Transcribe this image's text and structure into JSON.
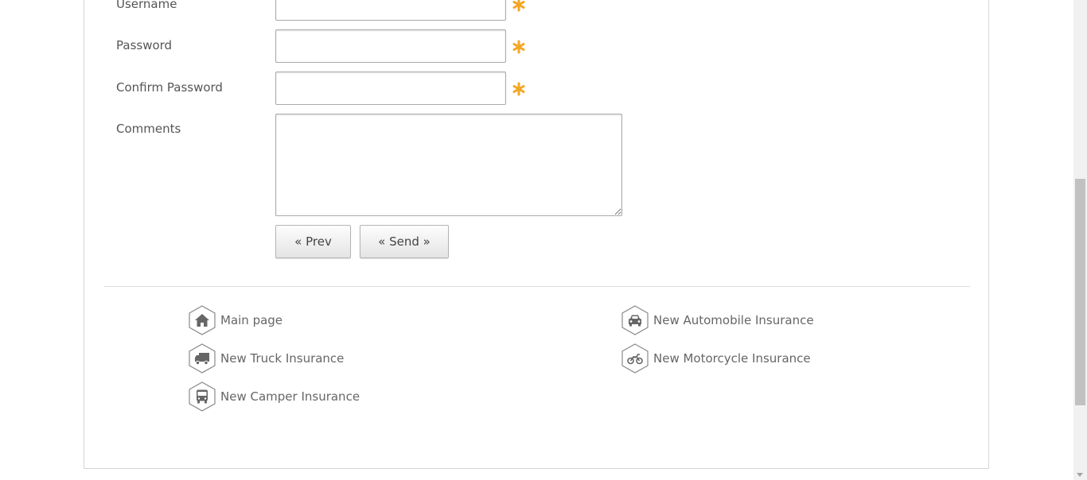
{
  "form": {
    "username": {
      "label": "Username",
      "value": "",
      "placeholder": ""
    },
    "password": {
      "label": "Password",
      "value": "",
      "placeholder": ""
    },
    "confirm_password": {
      "label": "Confirm Password",
      "value": "",
      "placeholder": ""
    },
    "comments": {
      "label": "Comments",
      "value": "",
      "placeholder": ""
    },
    "required_icon": "asterisk-icon",
    "required_color": "#f5a623"
  },
  "buttons": {
    "prev_label": "« Prev",
    "send_label": "« Send »"
  },
  "footer_nav": {
    "links": [
      {
        "label": "Main page",
        "icon": "home-icon"
      },
      {
        "label": "New Automobile Insurance",
        "icon": "car-icon"
      },
      {
        "label": "New Truck Insurance",
        "icon": "truck-icon"
      },
      {
        "label": "New Motorcycle Insurance",
        "icon": "motorcycle-icon"
      },
      {
        "label": "New Camper Insurance",
        "icon": "bus-icon"
      }
    ]
  }
}
